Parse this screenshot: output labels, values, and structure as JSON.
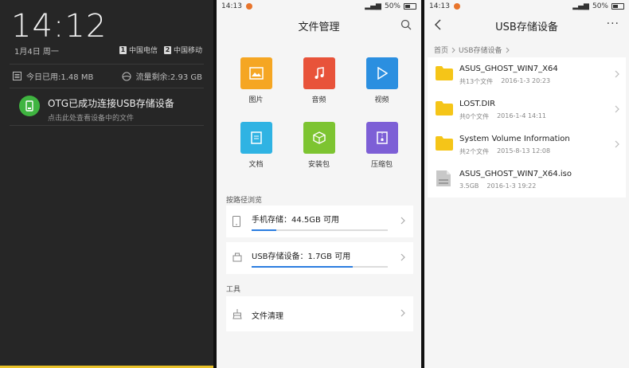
{
  "shade": {
    "time": "14:12",
    "date": "1月4日 周一",
    "carriers": [
      {
        "sim": "1",
        "name": "中国电信"
      },
      {
        "sim": "2",
        "name": "中国移动"
      }
    ],
    "data_used": "今日已用:1.48 MB",
    "data_left": "流量剩余:2.93 GB",
    "notification": {
      "title": "OTG已成功连接USB存储设备",
      "subtitle": "点击此处查看设备中的文件"
    }
  },
  "file_manager": {
    "status": {
      "time": "14:13",
      "battery": "50%"
    },
    "title": "文件管理",
    "categories": [
      {
        "label": "图片",
        "color": "#f5a623",
        "icon": "image-icon"
      },
      {
        "label": "音频",
        "color": "#e8533a",
        "icon": "music-icon"
      },
      {
        "label": "视频",
        "color": "#2b8fe0",
        "icon": "play-icon"
      },
      {
        "label": "文档",
        "color": "#2fb3e3",
        "icon": "document-icon"
      },
      {
        "label": "安装包",
        "color": "#7dc431",
        "icon": "package-icon"
      },
      {
        "label": "压缩包",
        "color": "#7d5fd6",
        "icon": "archive-icon"
      }
    ],
    "browse_heading": "按路径浏览",
    "storages": [
      {
        "label": "手机存储：44.5GB 可用",
        "fill": 0.18
      },
      {
        "label": "USB存储设备：1.7GB 可用",
        "fill": 0.74
      }
    ],
    "tools_heading": "工具",
    "tools": [
      {
        "label": "文件清理"
      }
    ]
  },
  "usb": {
    "status": {
      "time": "14:13",
      "battery": "50%"
    },
    "title": "USB存储设备",
    "breadcrumb": [
      "首页",
      "USB存储设备"
    ],
    "items": [
      {
        "name": "ASUS_GHOST_WIN7_X64",
        "count": "共13个文件",
        "date": "2016-1-3 20:23",
        "type": "folder"
      },
      {
        "name": "LOST.DIR",
        "count": "共0个文件",
        "date": "2016-1-4 14:11",
        "type": "folder"
      },
      {
        "name": "System Volume Information",
        "count": "共2个文件",
        "date": "2015-8-13 12:08",
        "type": "folder"
      },
      {
        "name": "ASUS_GHOST_WIN7_X64.iso",
        "count": "3.5GB",
        "date": "2016-1-3 19:22",
        "type": "file"
      }
    ]
  }
}
